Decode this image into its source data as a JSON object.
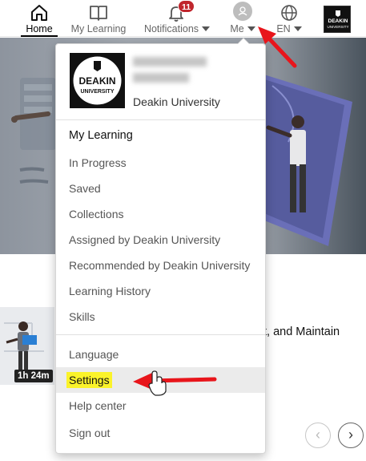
{
  "nav": {
    "home_label": "Home",
    "my_learning_label": "My Learning",
    "notifications_label": "Notifications",
    "notifications_count": "11",
    "me_label": "Me",
    "language_label": "EN",
    "org_logo_text_line1": "DEAKIN",
    "org_logo_text_line2": "UNIVERSITY"
  },
  "profile_menu": {
    "org_logo_line1": "DEAKIN",
    "org_logo_line2": "UNIVERSITY",
    "organization": "Deakin University",
    "items": [
      {
        "label": "My Learning"
      },
      {
        "label": "In Progress"
      },
      {
        "label": "Saved"
      },
      {
        "label": "Collections"
      },
      {
        "label": "Assigned by Deakin University"
      },
      {
        "label": "Recommended by Deakin University"
      },
      {
        "label": "Learning History"
      },
      {
        "label": "Skills"
      },
      {
        "label": "Language"
      },
      {
        "label": "Settings"
      },
      {
        "label": "Help center"
      },
      {
        "label": "Sign out"
      }
    ]
  },
  "content": {
    "course_duration": "1h 24m",
    "course_title_fragment": "t, and Maintain"
  },
  "colors": {
    "badge": "#c0262d",
    "highlight": "#fbf32a",
    "annotation_arrow": "#e8151b"
  }
}
